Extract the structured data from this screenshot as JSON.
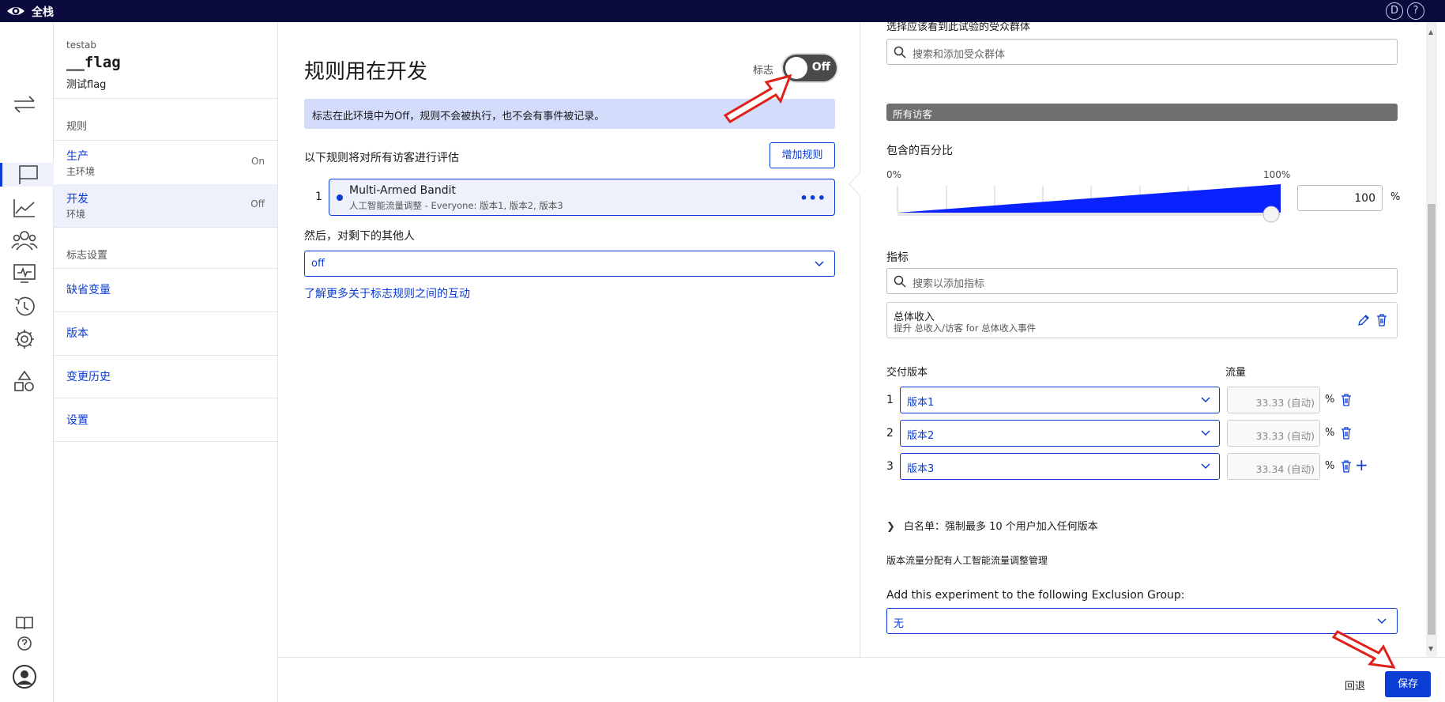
{
  "app": {
    "name": "全栈"
  },
  "topbar": {
    "user_initial": "D",
    "help_symbol": "?"
  },
  "flag": {
    "project": "testab",
    "key": "__flag",
    "name": "测试flag"
  },
  "sidebar": {
    "rules_header": "规则",
    "environments": [
      {
        "name": "生产",
        "sub": "主环境",
        "status": "On"
      },
      {
        "name": "开发",
        "sub": "环境",
        "status": "Off"
      }
    ],
    "settings_header": "标志设置",
    "links": [
      "缺省变量",
      "版本",
      "变更历史",
      "设置"
    ]
  },
  "main": {
    "title": "规则用在开发",
    "flag_label": "标志",
    "toggle_label": "Off",
    "banner": "标志在此环境中为Off，规则不会被执行，也不会有事件被记录。",
    "rules_hint": "以下规则将对所有访客进行评估",
    "add_rule": "增加规则",
    "rule": {
      "number": "1",
      "title": "Multi-Armed Bandit",
      "summary": "人工智能流量调整 - Everyone: 版本1, 版本2, 版本3"
    },
    "then_label": "然后，对剩下的其他人",
    "fallthrough_value": "off",
    "learn_more": "了解更多关于标志规则之间的互动"
  },
  "panel": {
    "audience_label": "选择应该看到此试验的受众群体",
    "audience_placeholder": "搜索和添加受众群体",
    "group_name": "所有访客",
    "percent_label": "包含的百分比",
    "tick_min": "0%",
    "tick_max": "100%",
    "percent_value": "100",
    "percent_sign": "%",
    "metrics_label": "指标",
    "metrics_placeholder": "搜索以添加指标",
    "metric": {
      "name": "总体收入",
      "desc": "提升 总收入/访客 for 总体收入事件"
    },
    "variations_label": "交付版本",
    "traffic_label": "流量",
    "variations": [
      {
        "num": "1",
        "name": "版本1",
        "traffic": "33.33 (自动)",
        "pct": "%"
      },
      {
        "num": "2",
        "name": "版本2",
        "traffic": "33.33 (自动)",
        "pct": "%"
      },
      {
        "num": "3",
        "name": "版本3",
        "traffic": "33.34 (自动)",
        "pct": "%"
      }
    ],
    "add_variation": "+",
    "whitelist": "白名单：强制最多 10 个用户加入任何版本",
    "managed_note": "版本流量分配有人工智能流量调整管理",
    "exclusion_label": "Add this experiment to the following Exclusion Group:",
    "exclusion_value": "无"
  },
  "footer": {
    "revert": "回退",
    "save": "保存"
  },
  "colors": {
    "accent": "#0b3cd4",
    "topbar": "#0a0a3c",
    "banner": "#d4dcfb",
    "annotation": "#e0201b"
  }
}
